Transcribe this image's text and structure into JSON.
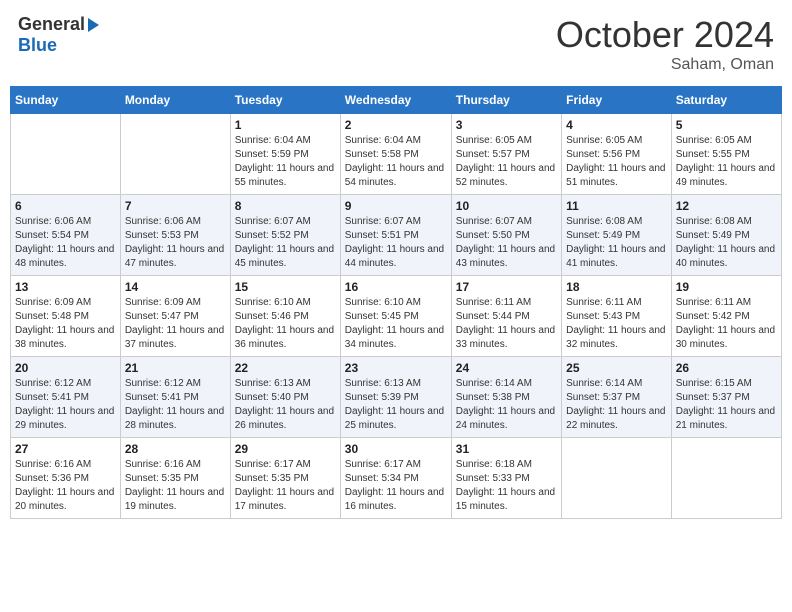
{
  "header": {
    "logo_general": "General",
    "logo_blue": "Blue",
    "month_title": "October 2024",
    "location": "Saham, Oman"
  },
  "days_of_week": [
    "Sunday",
    "Monday",
    "Tuesday",
    "Wednesday",
    "Thursday",
    "Friday",
    "Saturday"
  ],
  "weeks": [
    [
      {
        "day": "",
        "info": ""
      },
      {
        "day": "",
        "info": ""
      },
      {
        "day": "1",
        "info": "Sunrise: 6:04 AM\nSunset: 5:59 PM\nDaylight: 11 hours and 55 minutes."
      },
      {
        "day": "2",
        "info": "Sunrise: 6:04 AM\nSunset: 5:58 PM\nDaylight: 11 hours and 54 minutes."
      },
      {
        "day": "3",
        "info": "Sunrise: 6:05 AM\nSunset: 5:57 PM\nDaylight: 11 hours and 52 minutes."
      },
      {
        "day": "4",
        "info": "Sunrise: 6:05 AM\nSunset: 5:56 PM\nDaylight: 11 hours and 51 minutes."
      },
      {
        "day": "5",
        "info": "Sunrise: 6:05 AM\nSunset: 5:55 PM\nDaylight: 11 hours and 49 minutes."
      }
    ],
    [
      {
        "day": "6",
        "info": "Sunrise: 6:06 AM\nSunset: 5:54 PM\nDaylight: 11 hours and 48 minutes."
      },
      {
        "day": "7",
        "info": "Sunrise: 6:06 AM\nSunset: 5:53 PM\nDaylight: 11 hours and 47 minutes."
      },
      {
        "day": "8",
        "info": "Sunrise: 6:07 AM\nSunset: 5:52 PM\nDaylight: 11 hours and 45 minutes."
      },
      {
        "day": "9",
        "info": "Sunrise: 6:07 AM\nSunset: 5:51 PM\nDaylight: 11 hours and 44 minutes."
      },
      {
        "day": "10",
        "info": "Sunrise: 6:07 AM\nSunset: 5:50 PM\nDaylight: 11 hours and 43 minutes."
      },
      {
        "day": "11",
        "info": "Sunrise: 6:08 AM\nSunset: 5:49 PM\nDaylight: 11 hours and 41 minutes."
      },
      {
        "day": "12",
        "info": "Sunrise: 6:08 AM\nSunset: 5:49 PM\nDaylight: 11 hours and 40 minutes."
      }
    ],
    [
      {
        "day": "13",
        "info": "Sunrise: 6:09 AM\nSunset: 5:48 PM\nDaylight: 11 hours and 38 minutes."
      },
      {
        "day": "14",
        "info": "Sunrise: 6:09 AM\nSunset: 5:47 PM\nDaylight: 11 hours and 37 minutes."
      },
      {
        "day": "15",
        "info": "Sunrise: 6:10 AM\nSunset: 5:46 PM\nDaylight: 11 hours and 36 minutes."
      },
      {
        "day": "16",
        "info": "Sunrise: 6:10 AM\nSunset: 5:45 PM\nDaylight: 11 hours and 34 minutes."
      },
      {
        "day": "17",
        "info": "Sunrise: 6:11 AM\nSunset: 5:44 PM\nDaylight: 11 hours and 33 minutes."
      },
      {
        "day": "18",
        "info": "Sunrise: 6:11 AM\nSunset: 5:43 PM\nDaylight: 11 hours and 32 minutes."
      },
      {
        "day": "19",
        "info": "Sunrise: 6:11 AM\nSunset: 5:42 PM\nDaylight: 11 hours and 30 minutes."
      }
    ],
    [
      {
        "day": "20",
        "info": "Sunrise: 6:12 AM\nSunset: 5:41 PM\nDaylight: 11 hours and 29 minutes."
      },
      {
        "day": "21",
        "info": "Sunrise: 6:12 AM\nSunset: 5:41 PM\nDaylight: 11 hours and 28 minutes."
      },
      {
        "day": "22",
        "info": "Sunrise: 6:13 AM\nSunset: 5:40 PM\nDaylight: 11 hours and 26 minutes."
      },
      {
        "day": "23",
        "info": "Sunrise: 6:13 AM\nSunset: 5:39 PM\nDaylight: 11 hours and 25 minutes."
      },
      {
        "day": "24",
        "info": "Sunrise: 6:14 AM\nSunset: 5:38 PM\nDaylight: 11 hours and 24 minutes."
      },
      {
        "day": "25",
        "info": "Sunrise: 6:14 AM\nSunset: 5:37 PM\nDaylight: 11 hours and 22 minutes."
      },
      {
        "day": "26",
        "info": "Sunrise: 6:15 AM\nSunset: 5:37 PM\nDaylight: 11 hours and 21 minutes."
      }
    ],
    [
      {
        "day": "27",
        "info": "Sunrise: 6:16 AM\nSunset: 5:36 PM\nDaylight: 11 hours and 20 minutes."
      },
      {
        "day": "28",
        "info": "Sunrise: 6:16 AM\nSunset: 5:35 PM\nDaylight: 11 hours and 19 minutes."
      },
      {
        "day": "29",
        "info": "Sunrise: 6:17 AM\nSunset: 5:35 PM\nDaylight: 11 hours and 17 minutes."
      },
      {
        "day": "30",
        "info": "Sunrise: 6:17 AM\nSunset: 5:34 PM\nDaylight: 11 hours and 16 minutes."
      },
      {
        "day": "31",
        "info": "Sunrise: 6:18 AM\nSunset: 5:33 PM\nDaylight: 11 hours and 15 minutes."
      },
      {
        "day": "",
        "info": ""
      },
      {
        "day": "",
        "info": ""
      }
    ]
  ]
}
